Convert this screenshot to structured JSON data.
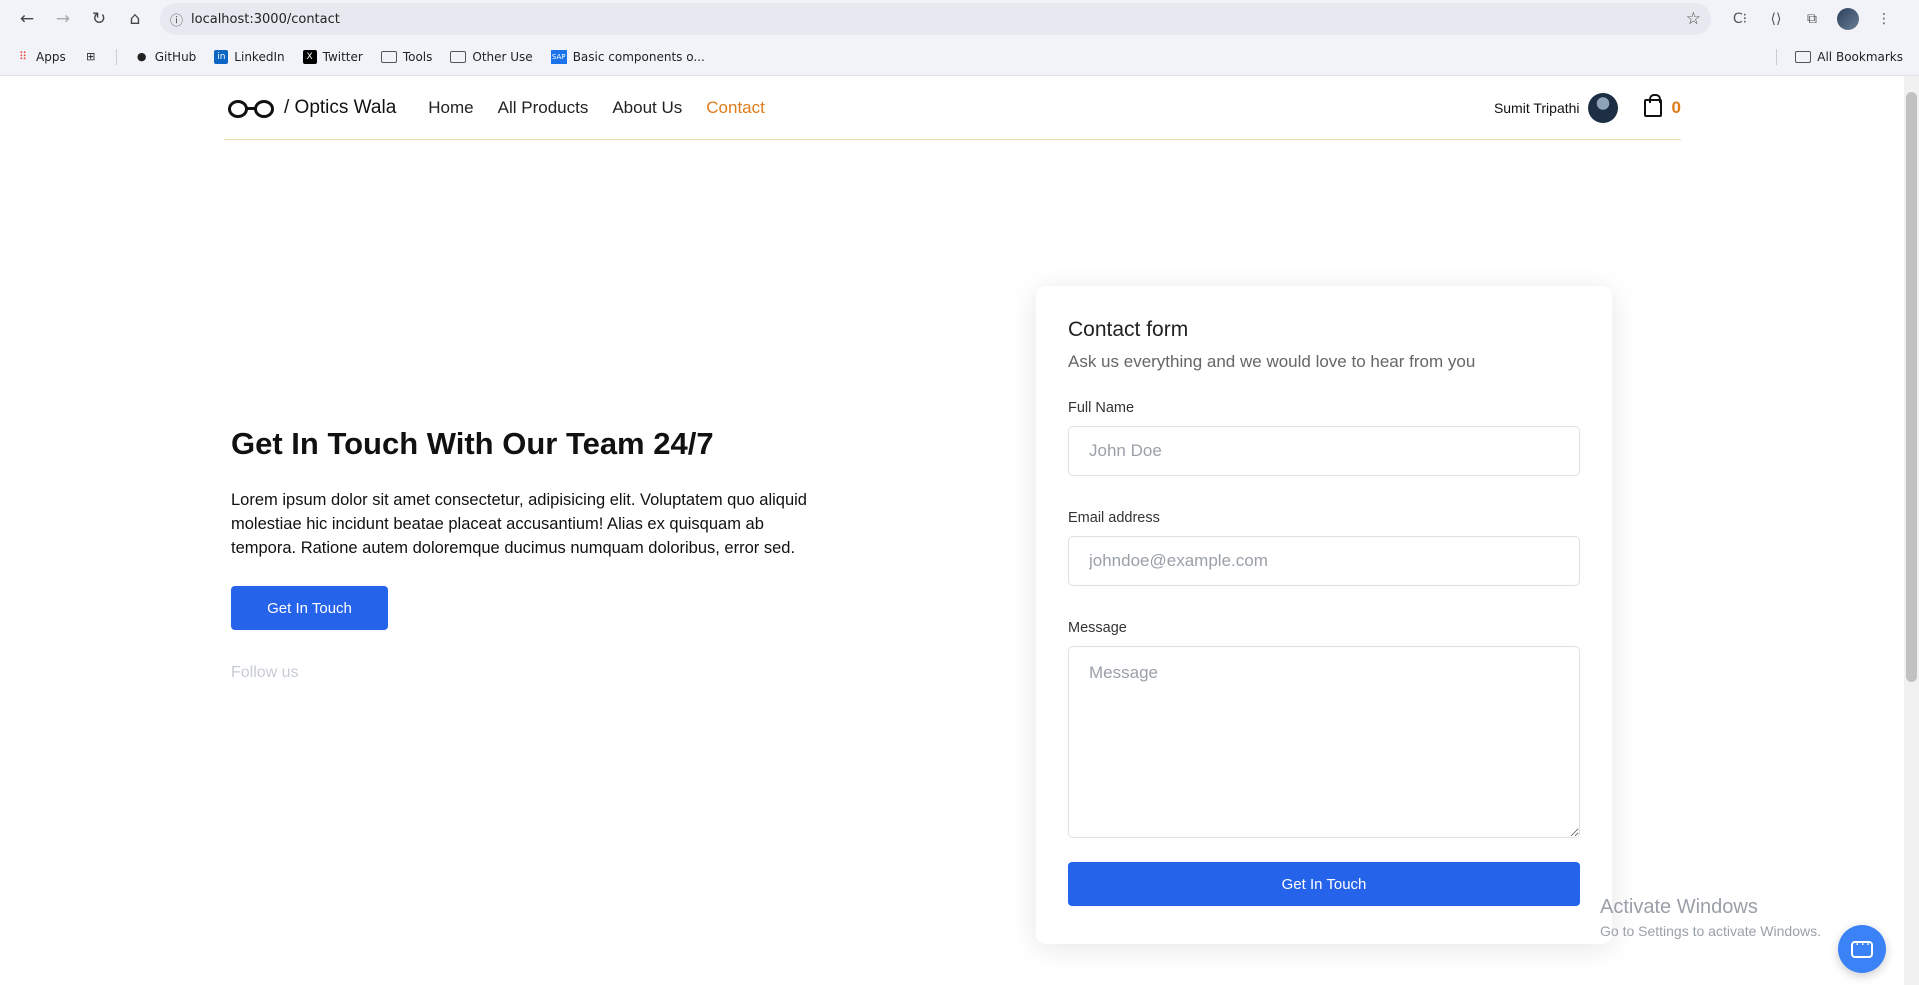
{
  "browser": {
    "url": "localhost:3000/contact",
    "bookmarks": [
      {
        "label": "Apps",
        "icon": "apps-grid-icon"
      },
      {
        "label": "GitHub",
        "icon": "github-icon"
      },
      {
        "label": "LinkedIn",
        "icon": "linkedin-icon"
      },
      {
        "label": "Twitter",
        "icon": "x-twitter-icon"
      },
      {
        "label": "Tools",
        "icon": "folder-icon"
      },
      {
        "label": "Other Use",
        "icon": "folder-icon"
      },
      {
        "label": "Basic components o...",
        "icon": "sap-icon"
      }
    ],
    "all_bookmarks": "All Bookmarks"
  },
  "header": {
    "logo_text": "/ Optics Wala",
    "nav": [
      {
        "label": "Home",
        "active": false
      },
      {
        "label": "All Products",
        "active": false
      },
      {
        "label": "About Us",
        "active": false
      },
      {
        "label": "Contact",
        "active": true
      }
    ],
    "user_name": "Sumit Tripathi",
    "cart_count": "0",
    "accent_color": "#e07b1a"
  },
  "hero": {
    "title": "Get In Touch With Our Team 24/7",
    "body": "Lorem ipsum dolor sit amet consectetur, adipisicing elit. Voluptatem quo aliquid molestiae hic incidunt beatae placeat accusantium! Alias ex quisquam ab tempora. Ratione autem doloremque ducimus numquam doloribus, error sed.",
    "button": "Get In Touch",
    "follow": "Follow us"
  },
  "form": {
    "title": "Contact form",
    "subtitle": "Ask us everything and we would love to hear from you",
    "name_label": "Full Name",
    "name_placeholder": "John Doe",
    "email_label": "Email address",
    "email_placeholder": "johndoe@example.com",
    "message_label": "Message",
    "message_placeholder": "Message",
    "submit": "Get In Touch",
    "button_color": "#2563eb"
  },
  "watermark": {
    "line1": "Activate Windows",
    "line2": "Go to Settings to activate Windows."
  }
}
